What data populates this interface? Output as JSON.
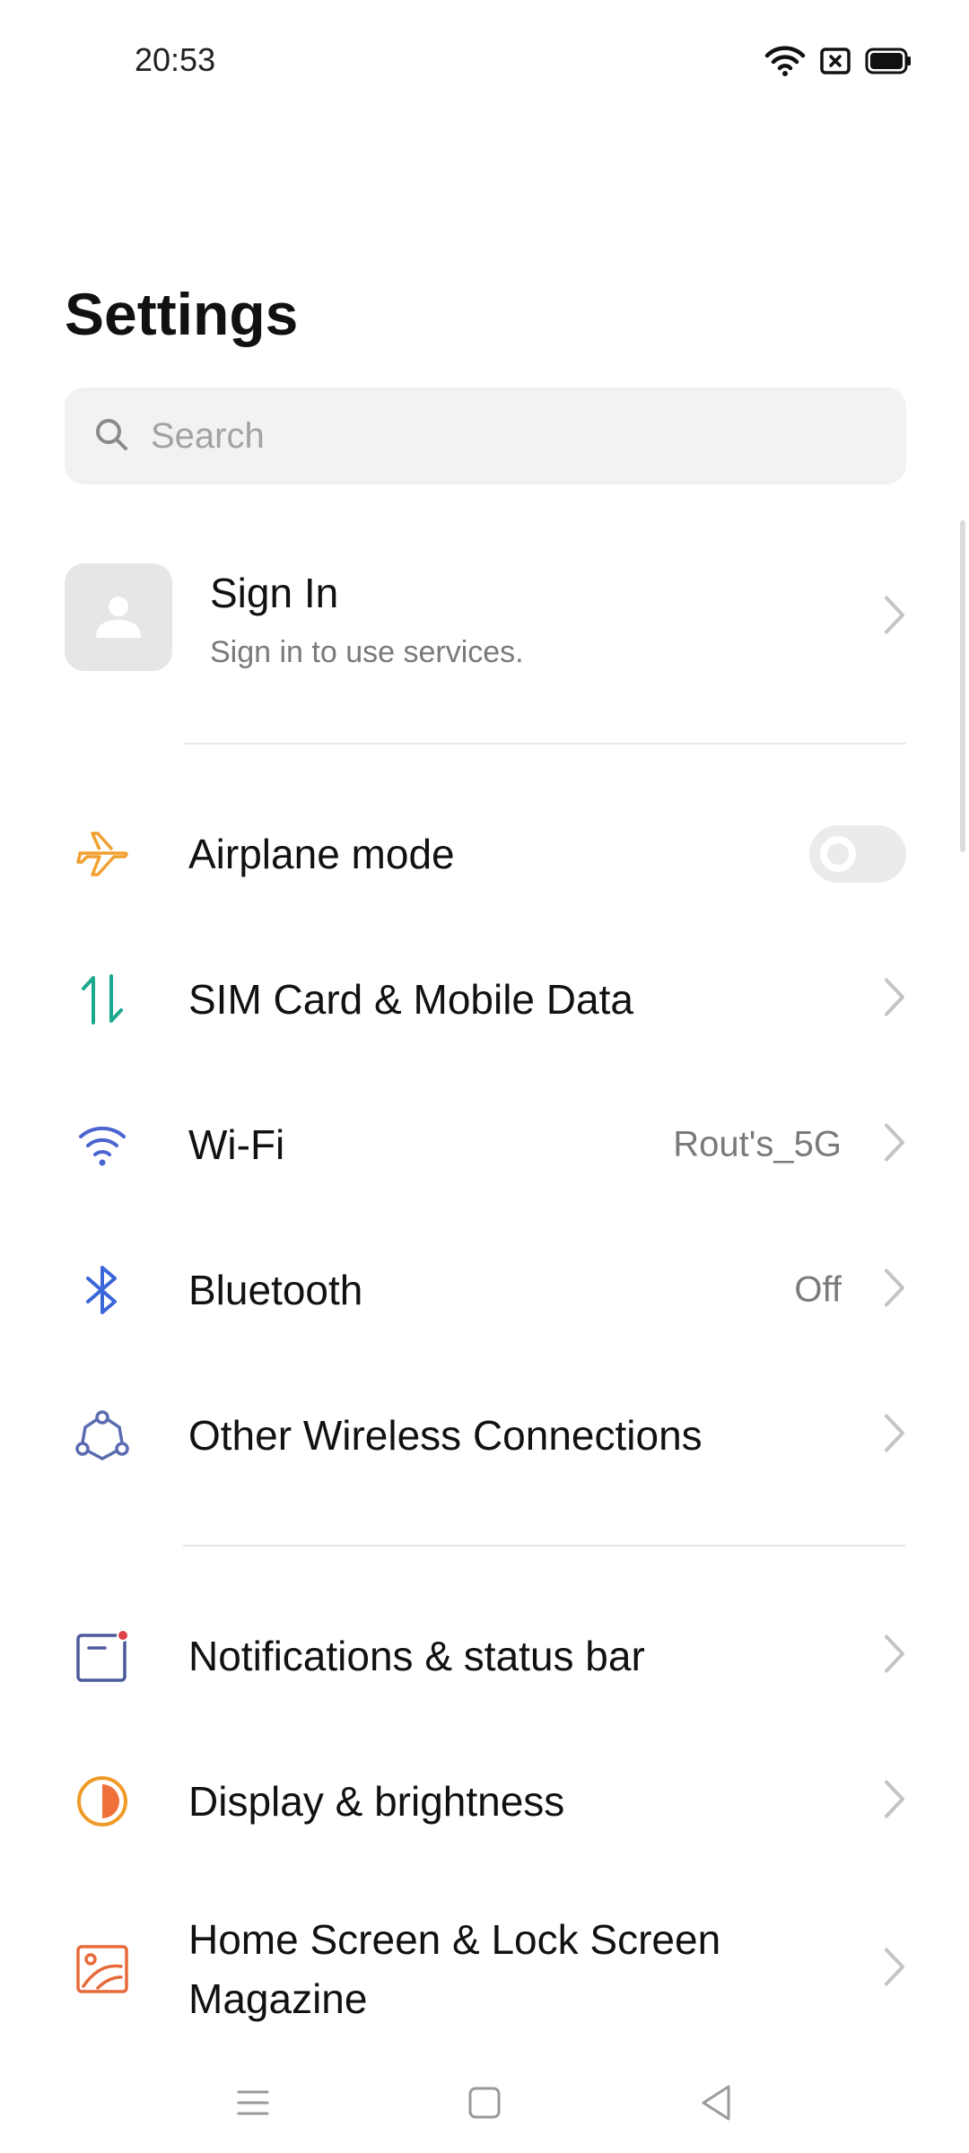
{
  "status_bar": {
    "time": "20:53",
    "icons": [
      "wifi-icon",
      "sim-off-icon",
      "battery-icon"
    ]
  },
  "page_title": "Settings",
  "search": {
    "placeholder": "Search",
    "icon": "search-icon"
  },
  "account": {
    "title": "Sign In",
    "subtitle": "Sign in to use services.",
    "icon": "person-icon"
  },
  "sections": [
    {
      "items": [
        {
          "label": "Airplane mode",
          "icon": "airplane-icon",
          "color": "#f0a030",
          "control": "toggle",
          "toggle_on": false
        },
        {
          "label": "SIM Card & Mobile Data",
          "icon": "data-arrows-icon",
          "color": "#1aa88f",
          "control": "chevron"
        },
        {
          "label": "Wi-Fi",
          "value": "Rout's_5G",
          "icon": "wifi-icon",
          "color": "#4a64d0",
          "control": "chevron"
        },
        {
          "label": "Bluetooth",
          "value": "Off",
          "icon": "bluetooth-icon",
          "color": "#3a66d8",
          "control": "chevron"
        },
        {
          "label": "Other Wireless Connections",
          "icon": "connections-icon",
          "color": "#5a6bb0",
          "control": "chevron"
        }
      ]
    },
    {
      "items": [
        {
          "label": "Notifications & status bar",
          "icon": "notification-icon",
          "color": "#4a5a9a",
          "accent": "#e0424a",
          "control": "chevron"
        },
        {
          "label": "Display & brightness",
          "icon": "brightness-icon",
          "color": "#f09a28",
          "control": "chevron"
        },
        {
          "label": "Home Screen & Lock Screen Magazine",
          "icon": "wallpaper-icon",
          "color": "#e86a3a",
          "control": "chevron"
        }
      ]
    }
  ],
  "nav_bar": [
    "menu-icon",
    "home-icon",
    "back-icon"
  ]
}
